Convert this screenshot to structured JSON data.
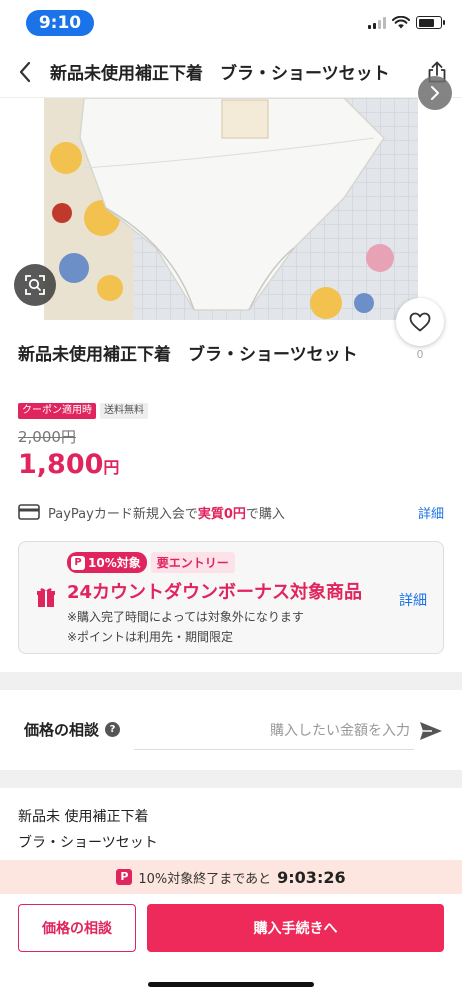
{
  "status_bar": {
    "time": "9:10"
  },
  "header": {
    "title": "新品未使用補正下着　ブラ・ショーツセット"
  },
  "product": {
    "title": "新品未使用補正下着　ブラ・ショーツセット",
    "like_count": "0"
  },
  "pricing": {
    "coupon_badge": "クーポン適用時",
    "shipping_badge": "送料無料",
    "original_price": "2,000円",
    "sale_price": "1,800",
    "sale_currency": "円"
  },
  "card_offer": {
    "text_before": "PayPayカード新規入会で",
    "text_highlight": "実質0円",
    "text_after": "で購入",
    "detail_label": "詳細"
  },
  "promo": {
    "tag_pp": "P",
    "tag_percent": "10%対象",
    "tag_entry": "要エントリー",
    "title": "24カウントダウンボーナス対象商品",
    "note1": "※購入完了時間によっては対象外になります",
    "note2": "※ポイントは利用先・期間限定",
    "detail_label": "詳細"
  },
  "negotiation": {
    "label": "価格の相談",
    "help": "?",
    "placeholder": "購入したい金額を入力"
  },
  "description": {
    "line1": "新品未 使用補正下着",
    "line2": "ブラ・ショーツセット"
  },
  "countdown": {
    "pp": "P",
    "text": "10%対象終了まであと",
    "time": "9:03:26"
  },
  "bottom_bar": {
    "negotiate_label": "価格の相談",
    "buy_label": "購入手続きへ"
  },
  "colors": {
    "accent": "#e0245e",
    "link": "#1a73e8",
    "buy_button": "#ee2a5a",
    "countdown_bg": "#fde6df"
  }
}
